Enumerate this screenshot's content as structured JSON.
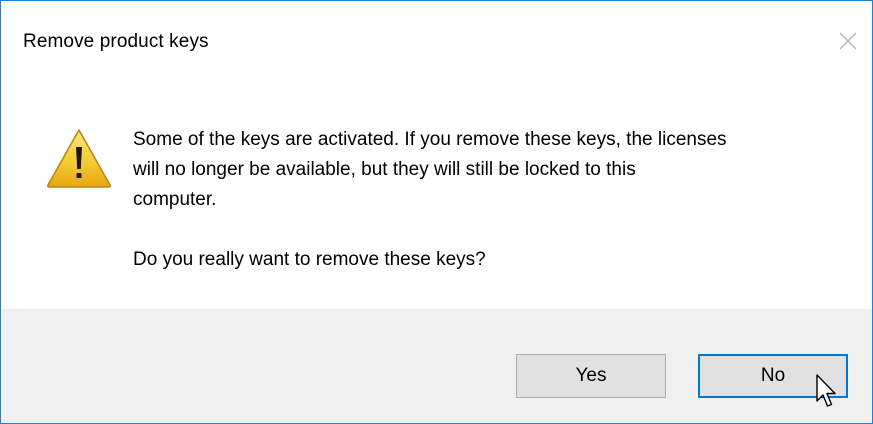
{
  "dialog": {
    "title": "Remove product keys",
    "close_icon": "close-icon",
    "icon": "warning-icon",
    "message_lines": [
      "Some of the keys are activated. If you remove these keys, the licenses",
      "will no longer be available, but they will still be locked to this",
      "computer."
    ],
    "question": "Do you really want to remove these keys?",
    "buttons": {
      "yes_label": "Yes",
      "no_label": "No"
    },
    "focused_button": "No"
  },
  "colors": {
    "border": "#1883d7",
    "footer_bg": "#f0f0f0",
    "button_bg": "#e1e1e1",
    "focus_border": "#0078d7",
    "warning_yellow": "#f5c518"
  }
}
